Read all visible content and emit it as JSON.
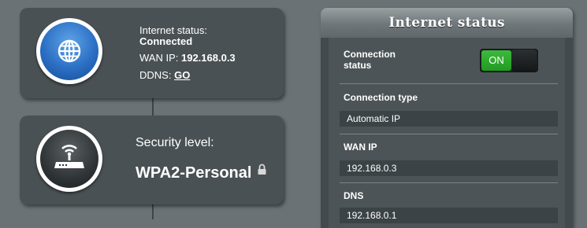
{
  "summary": {
    "internet": {
      "status_label": "Internet status:",
      "status_value": "Connected",
      "wan_label": "WAN IP:",
      "wan_value": "192.168.0.3",
      "ddns_label": "DDNS:",
      "ddns_link": "GO",
      "icon": "globe-icon"
    },
    "security": {
      "label": "Security level:",
      "value": "WPA2-Personal",
      "icon": "router-icon",
      "badge_icon": "lock-icon"
    }
  },
  "panel": {
    "title": "Internet status",
    "connection_status_label": "Connection\nstatus",
    "toggle_label": "ON",
    "connection_type_label": "Connection type",
    "connection_type_value": "Automatic IP",
    "wan_ip_label": "WAN IP",
    "wan_ip_value": "192.168.0.3",
    "dns_label": "DNS",
    "dns_value": "192.168.0.1"
  },
  "colors": {
    "background": "#6b7275",
    "card": "#4a5154",
    "toggle_on": "#2aa52a",
    "globe_blue": "#2b6fc4"
  }
}
